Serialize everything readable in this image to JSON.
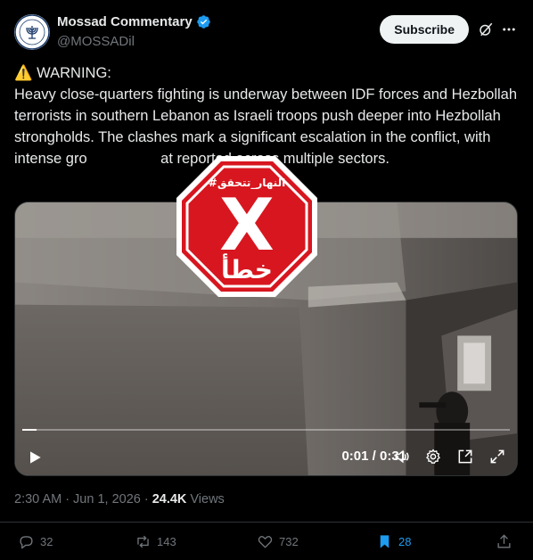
{
  "author": {
    "display_name": "Mossad Commentary",
    "handle": "@MOSSADil",
    "avatar_text": "MOSSAD"
  },
  "header": {
    "subscribe_label": "Subscribe"
  },
  "tweet": {
    "warning_emoji": "⚠️",
    "text": "WARNING:\nHeavy close-quarters fighting is underway between IDF forces and Hezbollah terrorists in southern Lebanon as Israeli troops push deeper into Hezbollah strongholds. The clashes mark a significant escalation in the conflict, with intense gro                  at reported across multiple sectors."
  },
  "video": {
    "current_time": "0:01",
    "duration": "0:31",
    "time_display": "0:01 / 0:31",
    "progress_fraction": 0.03
  },
  "stamp": {
    "tag_text": "#النهار_تتحقق",
    "x_mark": "X",
    "verdict": "خطأ",
    "color": "#d7161f"
  },
  "meta": {
    "time": "2:30 AM",
    "date": "Jun 1, 2026",
    "views_count": "24.4K",
    "views_label": "Views"
  },
  "actions": {
    "replies": "32",
    "reposts": "143",
    "likes": "732",
    "bookmarks": "28"
  },
  "colors": {
    "background": "#000000",
    "text": "#e7e9ea",
    "muted": "#71767b",
    "accent": "#1d9bf0",
    "verified": "#1d9bf0"
  }
}
